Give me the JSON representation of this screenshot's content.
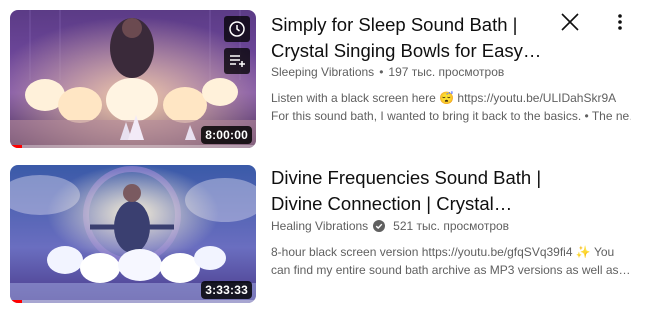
{
  "actions": {
    "close_icon": "close-icon",
    "more_icon": "more-vert-icon"
  },
  "videos": [
    {
      "title_line1": "Simply for Sleep Sound Bath |",
      "title_line2": "Crystal Singing Bowls for Easy…",
      "channel": "Sleeping Vibrations",
      "separator": "•",
      "views": "197 тыс. просмотров",
      "desc_line1_text": "Listen with a black screen here",
      "desc_line1_emoji": "😴",
      "desc_line1_link": "https://youtu.be/ULIDahSkr9A",
      "desc_line2": "For this sound bath, I wanted to bring it back to the basics. • The ne…",
      "duration": "8:00:00",
      "watch_progress": 0.05,
      "hover_icons": [
        "watch-later-icon",
        "add-to-queue-icon"
      ]
    },
    {
      "title_line1": "Divine Frequencies Sound Bath |",
      "title_line2": "Divine Connection | Crystal…",
      "channel": "Healing Vibrations",
      "verified": true,
      "views": "521 тыс. просмотров",
      "desc_line1_text": "8-hour black screen version https://youtu.be/gfqSVq39fi4",
      "desc_line1_emoji": "✨",
      "desc_line1_tail": "You",
      "desc_line2": "can find my entire sound bath archive as MP3 versions as well as…",
      "duration": "3:33:33",
      "watch_progress": 0.05
    }
  ],
  "colors": {
    "accent_red": "#ff0000",
    "meta_gray": "#606060",
    "title_black": "#0f0f0f"
  }
}
